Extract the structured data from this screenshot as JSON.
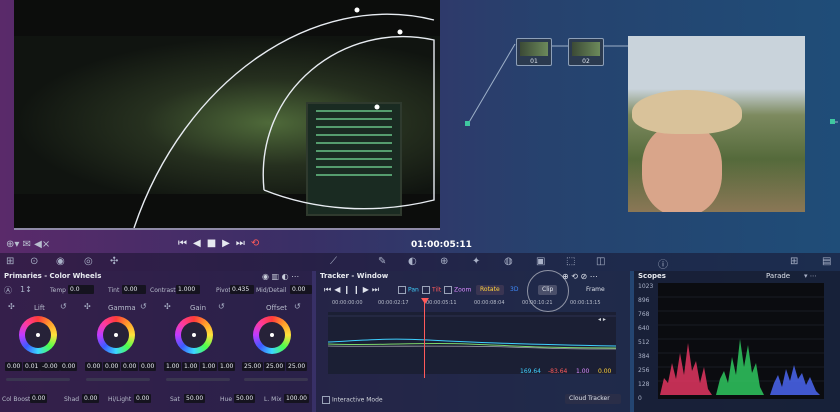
{
  "viewer": {
    "timecode": "01:00:05:11"
  },
  "nodes": [
    {
      "label": "01"
    },
    {
      "label": "02"
    }
  ],
  "primaries": {
    "title": "Primaries - Color Wheels",
    "temp_label": "Temp",
    "temp": "0.0",
    "tint_label": "Tint",
    "tint": "0.00",
    "contrast_label": "Contrast",
    "contrast": "1.000",
    "pivot_label": "Pivot",
    "pivot": "0.435",
    "middetail_label": "Mid/Detail",
    "middetail": "0.00",
    "wheels": [
      {
        "name": "Lift",
        "values": [
          "0.00",
          "0.01",
          "-0.00",
          "0.00"
        ]
      },
      {
        "name": "Gamma",
        "values": [
          "0.00",
          "0.00",
          "0.00",
          "0.00"
        ]
      },
      {
        "name": "Gain",
        "values": [
          "1.00",
          "1.00",
          "1.00",
          "1.00"
        ]
      },
      {
        "name": "Offset",
        "values": [
          "25.00",
          "25.00",
          "25.00"
        ]
      }
    ],
    "bottom": [
      {
        "label": "Col Boost",
        "value": "0.00"
      },
      {
        "label": "Shad",
        "value": "0.00"
      },
      {
        "label": "Hi/Light",
        "value": "0.00"
      },
      {
        "label": "Sat",
        "value": "50.00"
      },
      {
        "label": "Hue",
        "value": "50.00"
      },
      {
        "label": "L. Mix",
        "value": "100.00"
      }
    ]
  },
  "tracker": {
    "title": "Tracker - Window",
    "pan": "Pan",
    "tilt": "Tilt",
    "zoom": "Zoom",
    "rotate": "Rotate",
    "three_d": "3D",
    "clip": "Clip",
    "frame": "Frame",
    "times": [
      "00:00:00:00",
      "00:00:02:17",
      "00:00:05:11",
      "00:00:08:04",
      "00:00:10:21",
      "00:00:13:15"
    ],
    "readouts": [
      "169.64",
      "-83.64",
      "1.00",
      "0.00"
    ],
    "interactive_mode": "Interactive Mode",
    "cloud_tracker": "Cloud Tracker"
  },
  "scopes": {
    "title": "Scopes",
    "mode": "Parade",
    "ticks": [
      "1023",
      "896",
      "768",
      "640",
      "512",
      "384",
      "256",
      "128",
      "0"
    ]
  },
  "colors": {
    "red": "#ff3b6b",
    "green": "#34e06a",
    "blue": "#4f6bff",
    "accent_red": "#ff5a5a"
  }
}
